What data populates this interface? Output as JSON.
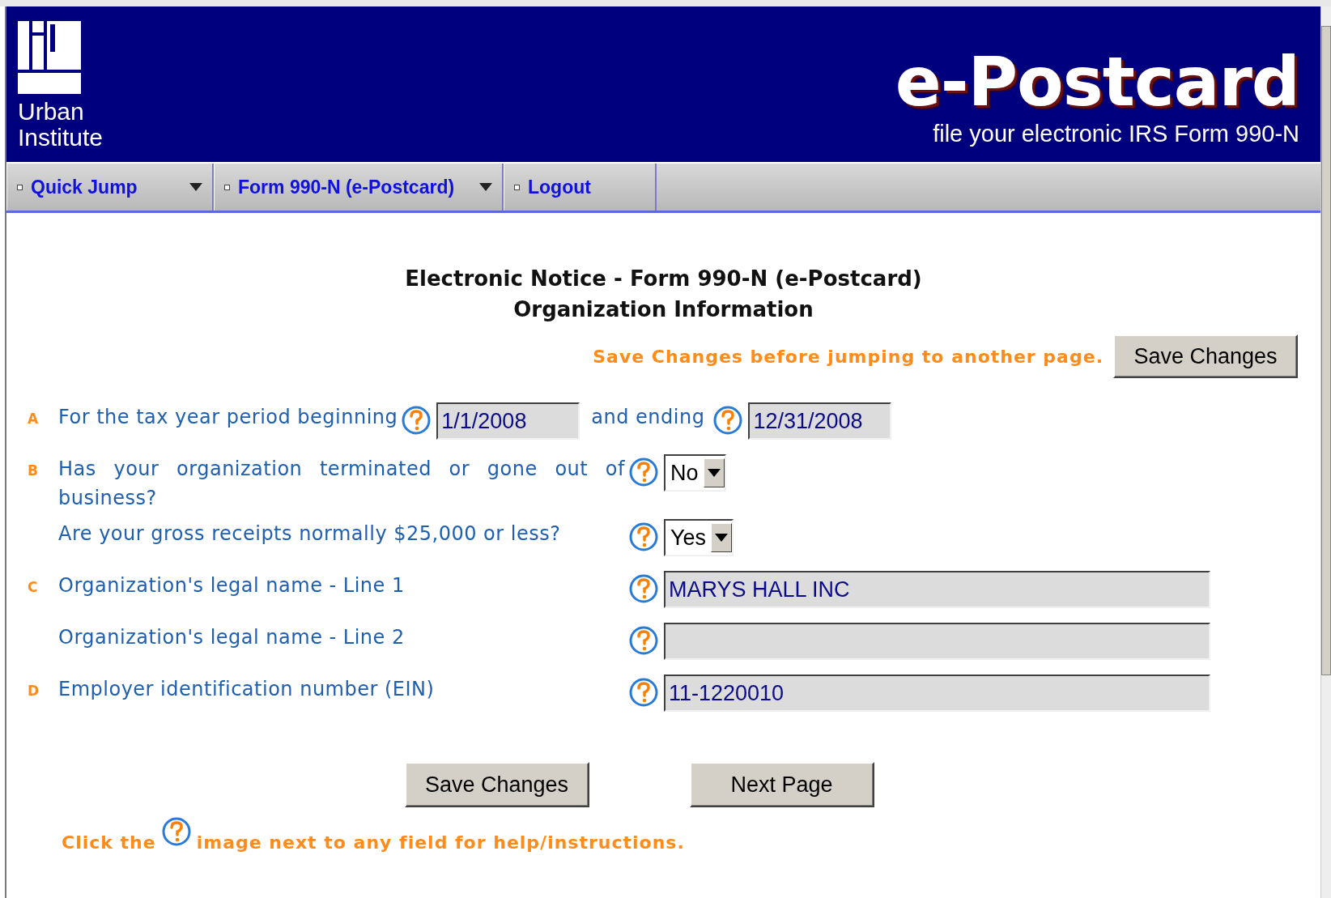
{
  "header": {
    "logo_lines": [
      "Urban",
      "Institute"
    ],
    "title": "e-Postcard",
    "subtitle": "file your electronic IRS Form 990-N"
  },
  "nav": [
    {
      "label": "Quick Jump",
      "dropdown": true
    },
    {
      "label": "Form 990-N (e-Postcard)",
      "dropdown": true
    },
    {
      "label": "Logout",
      "dropdown": false
    }
  ],
  "heading": [
    "Electronic Notice - Form 990-N (e-Postcard)",
    "Organization Information"
  ],
  "save_notice": "Save Changes before jumping to another page.",
  "top_button": "Save Changes",
  "rows": [
    {
      "kind": "dates",
      "letter": "A",
      "label": "For the tax year period beginning",
      "value": "1/1/2008",
      "label_2": "and ending",
      "value_2": "12/31/2008"
    },
    {
      "kind": "select",
      "letter": "B",
      "label": "Has your organization terminated or gone out of business?",
      "value": "No"
    },
    {
      "kind": "select",
      "label": "Are your gross receipts normally $25,000 or less?",
      "value": "Yes"
    },
    {
      "kind": "text",
      "letter": "C",
      "label": "Organization's legal name - Line 1",
      "value": "MARYS HALL INC"
    },
    {
      "kind": "text",
      "label": "Organization's legal name - Line 2"
    },
    {
      "kind": "text",
      "letter": "D",
      "label": "Employer identification number (EIN)",
      "value": "11-1220010"
    }
  ],
  "buttons": [
    "Save Changes",
    "Next Page"
  ],
  "help_note": {
    "before": "Click the",
    "after": "image next to any field for help/instructions."
  }
}
